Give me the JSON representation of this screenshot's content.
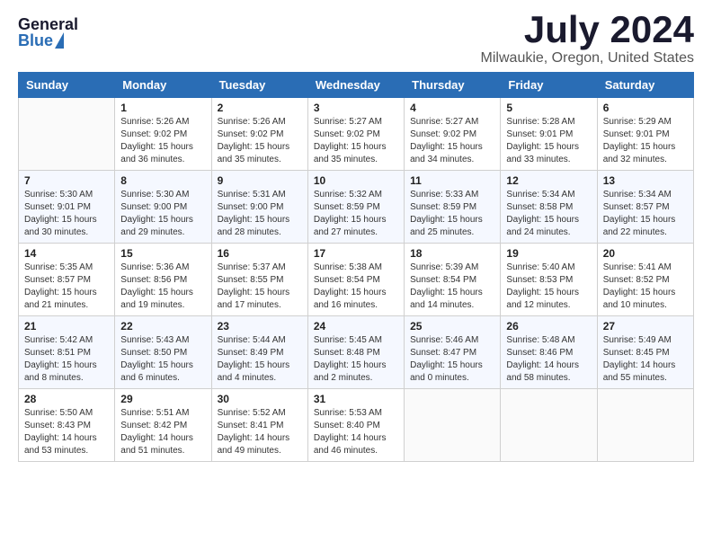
{
  "header": {
    "logo_general": "General",
    "logo_blue": "Blue",
    "month_title": "July 2024",
    "location": "Milwaukie, Oregon, United States"
  },
  "weekdays": [
    "Sunday",
    "Monday",
    "Tuesday",
    "Wednesday",
    "Thursday",
    "Friday",
    "Saturday"
  ],
  "weeks": [
    [
      {
        "day": "",
        "info": ""
      },
      {
        "day": "1",
        "info": "Sunrise: 5:26 AM\nSunset: 9:02 PM\nDaylight: 15 hours\nand 36 minutes."
      },
      {
        "day": "2",
        "info": "Sunrise: 5:26 AM\nSunset: 9:02 PM\nDaylight: 15 hours\nand 35 minutes."
      },
      {
        "day": "3",
        "info": "Sunrise: 5:27 AM\nSunset: 9:02 PM\nDaylight: 15 hours\nand 35 minutes."
      },
      {
        "day": "4",
        "info": "Sunrise: 5:27 AM\nSunset: 9:02 PM\nDaylight: 15 hours\nand 34 minutes."
      },
      {
        "day": "5",
        "info": "Sunrise: 5:28 AM\nSunset: 9:01 PM\nDaylight: 15 hours\nand 33 minutes."
      },
      {
        "day": "6",
        "info": "Sunrise: 5:29 AM\nSunset: 9:01 PM\nDaylight: 15 hours\nand 32 minutes."
      }
    ],
    [
      {
        "day": "7",
        "info": "Sunrise: 5:30 AM\nSunset: 9:01 PM\nDaylight: 15 hours\nand 30 minutes."
      },
      {
        "day": "8",
        "info": "Sunrise: 5:30 AM\nSunset: 9:00 PM\nDaylight: 15 hours\nand 29 minutes."
      },
      {
        "day": "9",
        "info": "Sunrise: 5:31 AM\nSunset: 9:00 PM\nDaylight: 15 hours\nand 28 minutes."
      },
      {
        "day": "10",
        "info": "Sunrise: 5:32 AM\nSunset: 8:59 PM\nDaylight: 15 hours\nand 27 minutes."
      },
      {
        "day": "11",
        "info": "Sunrise: 5:33 AM\nSunset: 8:59 PM\nDaylight: 15 hours\nand 25 minutes."
      },
      {
        "day": "12",
        "info": "Sunrise: 5:34 AM\nSunset: 8:58 PM\nDaylight: 15 hours\nand 24 minutes."
      },
      {
        "day": "13",
        "info": "Sunrise: 5:34 AM\nSunset: 8:57 PM\nDaylight: 15 hours\nand 22 minutes."
      }
    ],
    [
      {
        "day": "14",
        "info": "Sunrise: 5:35 AM\nSunset: 8:57 PM\nDaylight: 15 hours\nand 21 minutes."
      },
      {
        "day": "15",
        "info": "Sunrise: 5:36 AM\nSunset: 8:56 PM\nDaylight: 15 hours\nand 19 minutes."
      },
      {
        "day": "16",
        "info": "Sunrise: 5:37 AM\nSunset: 8:55 PM\nDaylight: 15 hours\nand 17 minutes."
      },
      {
        "day": "17",
        "info": "Sunrise: 5:38 AM\nSunset: 8:54 PM\nDaylight: 15 hours\nand 16 minutes."
      },
      {
        "day": "18",
        "info": "Sunrise: 5:39 AM\nSunset: 8:54 PM\nDaylight: 15 hours\nand 14 minutes."
      },
      {
        "day": "19",
        "info": "Sunrise: 5:40 AM\nSunset: 8:53 PM\nDaylight: 15 hours\nand 12 minutes."
      },
      {
        "day": "20",
        "info": "Sunrise: 5:41 AM\nSunset: 8:52 PM\nDaylight: 15 hours\nand 10 minutes."
      }
    ],
    [
      {
        "day": "21",
        "info": "Sunrise: 5:42 AM\nSunset: 8:51 PM\nDaylight: 15 hours\nand 8 minutes."
      },
      {
        "day": "22",
        "info": "Sunrise: 5:43 AM\nSunset: 8:50 PM\nDaylight: 15 hours\nand 6 minutes."
      },
      {
        "day": "23",
        "info": "Sunrise: 5:44 AM\nSunset: 8:49 PM\nDaylight: 15 hours\nand 4 minutes."
      },
      {
        "day": "24",
        "info": "Sunrise: 5:45 AM\nSunset: 8:48 PM\nDaylight: 15 hours\nand 2 minutes."
      },
      {
        "day": "25",
        "info": "Sunrise: 5:46 AM\nSunset: 8:47 PM\nDaylight: 15 hours\nand 0 minutes."
      },
      {
        "day": "26",
        "info": "Sunrise: 5:48 AM\nSunset: 8:46 PM\nDaylight: 14 hours\nand 58 minutes."
      },
      {
        "day": "27",
        "info": "Sunrise: 5:49 AM\nSunset: 8:45 PM\nDaylight: 14 hours\nand 55 minutes."
      }
    ],
    [
      {
        "day": "28",
        "info": "Sunrise: 5:50 AM\nSunset: 8:43 PM\nDaylight: 14 hours\nand 53 minutes."
      },
      {
        "day": "29",
        "info": "Sunrise: 5:51 AM\nSunset: 8:42 PM\nDaylight: 14 hours\nand 51 minutes."
      },
      {
        "day": "30",
        "info": "Sunrise: 5:52 AM\nSunset: 8:41 PM\nDaylight: 14 hours\nand 49 minutes."
      },
      {
        "day": "31",
        "info": "Sunrise: 5:53 AM\nSunset: 8:40 PM\nDaylight: 14 hours\nand 46 minutes."
      },
      {
        "day": "",
        "info": ""
      },
      {
        "day": "",
        "info": ""
      },
      {
        "day": "",
        "info": ""
      }
    ]
  ]
}
